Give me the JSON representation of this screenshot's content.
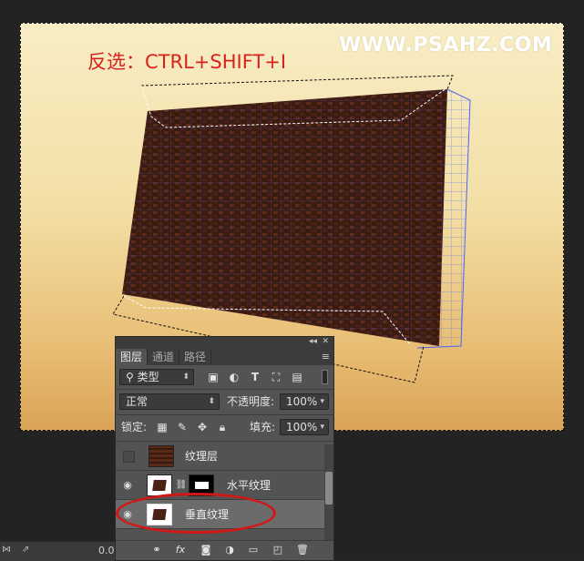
{
  "canvas": {
    "caption": "反选：CTRL+SHIFT+I",
    "watermark": "WWW.PSAHZ.COM"
  },
  "layers_panel": {
    "tabs": [
      {
        "label": "图层",
        "active": true
      },
      {
        "label": "通道",
        "active": false
      },
      {
        "label": "路径",
        "active": false
      }
    ],
    "filter_kind": "类型",
    "blend_mode": "正常",
    "opacity_label": "不透明度:",
    "opacity_value": "100%",
    "lock_label": "锁定:",
    "fill_label": "填充:",
    "fill_value": "100%",
    "layers": [
      {
        "name": "纹理层",
        "visible": false,
        "selected": false
      },
      {
        "name": "水平纹理",
        "visible": true,
        "selected": false,
        "has_mask": true
      },
      {
        "name": "垂直纹理",
        "visible": true,
        "selected": true
      }
    ],
    "footer_icons": [
      "link-icon",
      "fx-icon",
      "add-mask-icon",
      "adjustment-layer-icon",
      "new-group-icon",
      "new-layer-icon",
      "delete-icon"
    ]
  },
  "status_bar": {
    "zoom_value": "0.0"
  },
  "colors": {
    "accent_red": "#d01818",
    "panel_bg": "#535353",
    "selected_row": "#6b6b6b"
  }
}
